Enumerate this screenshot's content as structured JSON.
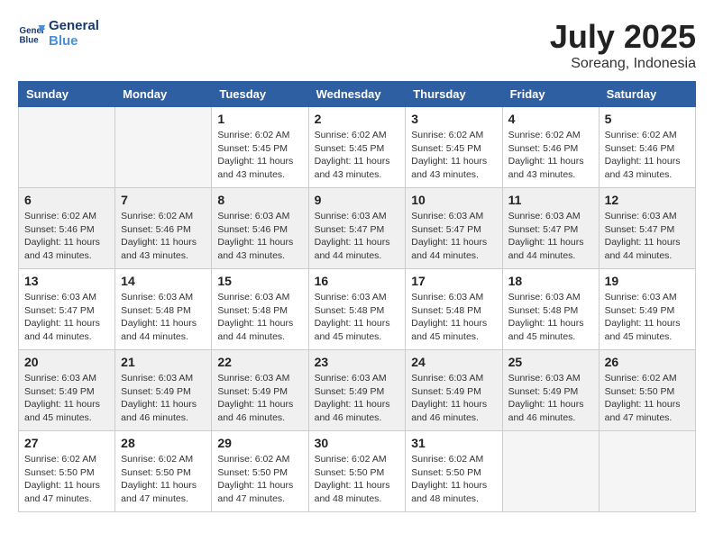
{
  "app": {
    "name": "General",
    "name2": "Blue"
  },
  "header": {
    "month": "July 2025",
    "location": "Soreang, Indonesia"
  },
  "weekdays": [
    "Sunday",
    "Monday",
    "Tuesday",
    "Wednesday",
    "Thursday",
    "Friday",
    "Saturday"
  ],
  "weeks": [
    [
      {
        "day": "",
        "empty": true
      },
      {
        "day": "",
        "empty": true
      },
      {
        "day": "1",
        "sunrise": "Sunrise: 6:02 AM",
        "sunset": "Sunset: 5:45 PM",
        "daylight": "Daylight: 11 hours and 43 minutes."
      },
      {
        "day": "2",
        "sunrise": "Sunrise: 6:02 AM",
        "sunset": "Sunset: 5:45 PM",
        "daylight": "Daylight: 11 hours and 43 minutes."
      },
      {
        "day": "3",
        "sunrise": "Sunrise: 6:02 AM",
        "sunset": "Sunset: 5:45 PM",
        "daylight": "Daylight: 11 hours and 43 minutes."
      },
      {
        "day": "4",
        "sunrise": "Sunrise: 6:02 AM",
        "sunset": "Sunset: 5:46 PM",
        "daylight": "Daylight: 11 hours and 43 minutes."
      },
      {
        "day": "5",
        "sunrise": "Sunrise: 6:02 AM",
        "sunset": "Sunset: 5:46 PM",
        "daylight": "Daylight: 11 hours and 43 minutes."
      }
    ],
    [
      {
        "day": "6",
        "sunrise": "Sunrise: 6:02 AM",
        "sunset": "Sunset: 5:46 PM",
        "daylight": "Daylight: 11 hours and 43 minutes."
      },
      {
        "day": "7",
        "sunrise": "Sunrise: 6:02 AM",
        "sunset": "Sunset: 5:46 PM",
        "daylight": "Daylight: 11 hours and 43 minutes."
      },
      {
        "day": "8",
        "sunrise": "Sunrise: 6:03 AM",
        "sunset": "Sunset: 5:46 PM",
        "daylight": "Daylight: 11 hours and 43 minutes."
      },
      {
        "day": "9",
        "sunrise": "Sunrise: 6:03 AM",
        "sunset": "Sunset: 5:47 PM",
        "daylight": "Daylight: 11 hours and 44 minutes."
      },
      {
        "day": "10",
        "sunrise": "Sunrise: 6:03 AM",
        "sunset": "Sunset: 5:47 PM",
        "daylight": "Daylight: 11 hours and 44 minutes."
      },
      {
        "day": "11",
        "sunrise": "Sunrise: 6:03 AM",
        "sunset": "Sunset: 5:47 PM",
        "daylight": "Daylight: 11 hours and 44 minutes."
      },
      {
        "day": "12",
        "sunrise": "Sunrise: 6:03 AM",
        "sunset": "Sunset: 5:47 PM",
        "daylight": "Daylight: 11 hours and 44 minutes."
      }
    ],
    [
      {
        "day": "13",
        "sunrise": "Sunrise: 6:03 AM",
        "sunset": "Sunset: 5:47 PM",
        "daylight": "Daylight: 11 hours and 44 minutes."
      },
      {
        "day": "14",
        "sunrise": "Sunrise: 6:03 AM",
        "sunset": "Sunset: 5:48 PM",
        "daylight": "Daylight: 11 hours and 44 minutes."
      },
      {
        "day": "15",
        "sunrise": "Sunrise: 6:03 AM",
        "sunset": "Sunset: 5:48 PM",
        "daylight": "Daylight: 11 hours and 44 minutes."
      },
      {
        "day": "16",
        "sunrise": "Sunrise: 6:03 AM",
        "sunset": "Sunset: 5:48 PM",
        "daylight": "Daylight: 11 hours and 45 minutes."
      },
      {
        "day": "17",
        "sunrise": "Sunrise: 6:03 AM",
        "sunset": "Sunset: 5:48 PM",
        "daylight": "Daylight: 11 hours and 45 minutes."
      },
      {
        "day": "18",
        "sunrise": "Sunrise: 6:03 AM",
        "sunset": "Sunset: 5:48 PM",
        "daylight": "Daylight: 11 hours and 45 minutes."
      },
      {
        "day": "19",
        "sunrise": "Sunrise: 6:03 AM",
        "sunset": "Sunset: 5:49 PM",
        "daylight": "Daylight: 11 hours and 45 minutes."
      }
    ],
    [
      {
        "day": "20",
        "sunrise": "Sunrise: 6:03 AM",
        "sunset": "Sunset: 5:49 PM",
        "daylight": "Daylight: 11 hours and 45 minutes."
      },
      {
        "day": "21",
        "sunrise": "Sunrise: 6:03 AM",
        "sunset": "Sunset: 5:49 PM",
        "daylight": "Daylight: 11 hours and 46 minutes."
      },
      {
        "day": "22",
        "sunrise": "Sunrise: 6:03 AM",
        "sunset": "Sunset: 5:49 PM",
        "daylight": "Daylight: 11 hours and 46 minutes."
      },
      {
        "day": "23",
        "sunrise": "Sunrise: 6:03 AM",
        "sunset": "Sunset: 5:49 PM",
        "daylight": "Daylight: 11 hours and 46 minutes."
      },
      {
        "day": "24",
        "sunrise": "Sunrise: 6:03 AM",
        "sunset": "Sunset: 5:49 PM",
        "daylight": "Daylight: 11 hours and 46 minutes."
      },
      {
        "day": "25",
        "sunrise": "Sunrise: 6:03 AM",
        "sunset": "Sunset: 5:49 PM",
        "daylight": "Daylight: 11 hours and 46 minutes."
      },
      {
        "day": "26",
        "sunrise": "Sunrise: 6:02 AM",
        "sunset": "Sunset: 5:50 PM",
        "daylight": "Daylight: 11 hours and 47 minutes."
      }
    ],
    [
      {
        "day": "27",
        "sunrise": "Sunrise: 6:02 AM",
        "sunset": "Sunset: 5:50 PM",
        "daylight": "Daylight: 11 hours and 47 minutes."
      },
      {
        "day": "28",
        "sunrise": "Sunrise: 6:02 AM",
        "sunset": "Sunset: 5:50 PM",
        "daylight": "Daylight: 11 hours and 47 minutes."
      },
      {
        "day": "29",
        "sunrise": "Sunrise: 6:02 AM",
        "sunset": "Sunset: 5:50 PM",
        "daylight": "Daylight: 11 hours and 47 minutes."
      },
      {
        "day": "30",
        "sunrise": "Sunrise: 6:02 AM",
        "sunset": "Sunset: 5:50 PM",
        "daylight": "Daylight: 11 hours and 48 minutes."
      },
      {
        "day": "31",
        "sunrise": "Sunrise: 6:02 AM",
        "sunset": "Sunset: 5:50 PM",
        "daylight": "Daylight: 11 hours and 48 minutes."
      },
      {
        "day": "",
        "empty": true
      },
      {
        "day": "",
        "empty": true
      }
    ]
  ]
}
